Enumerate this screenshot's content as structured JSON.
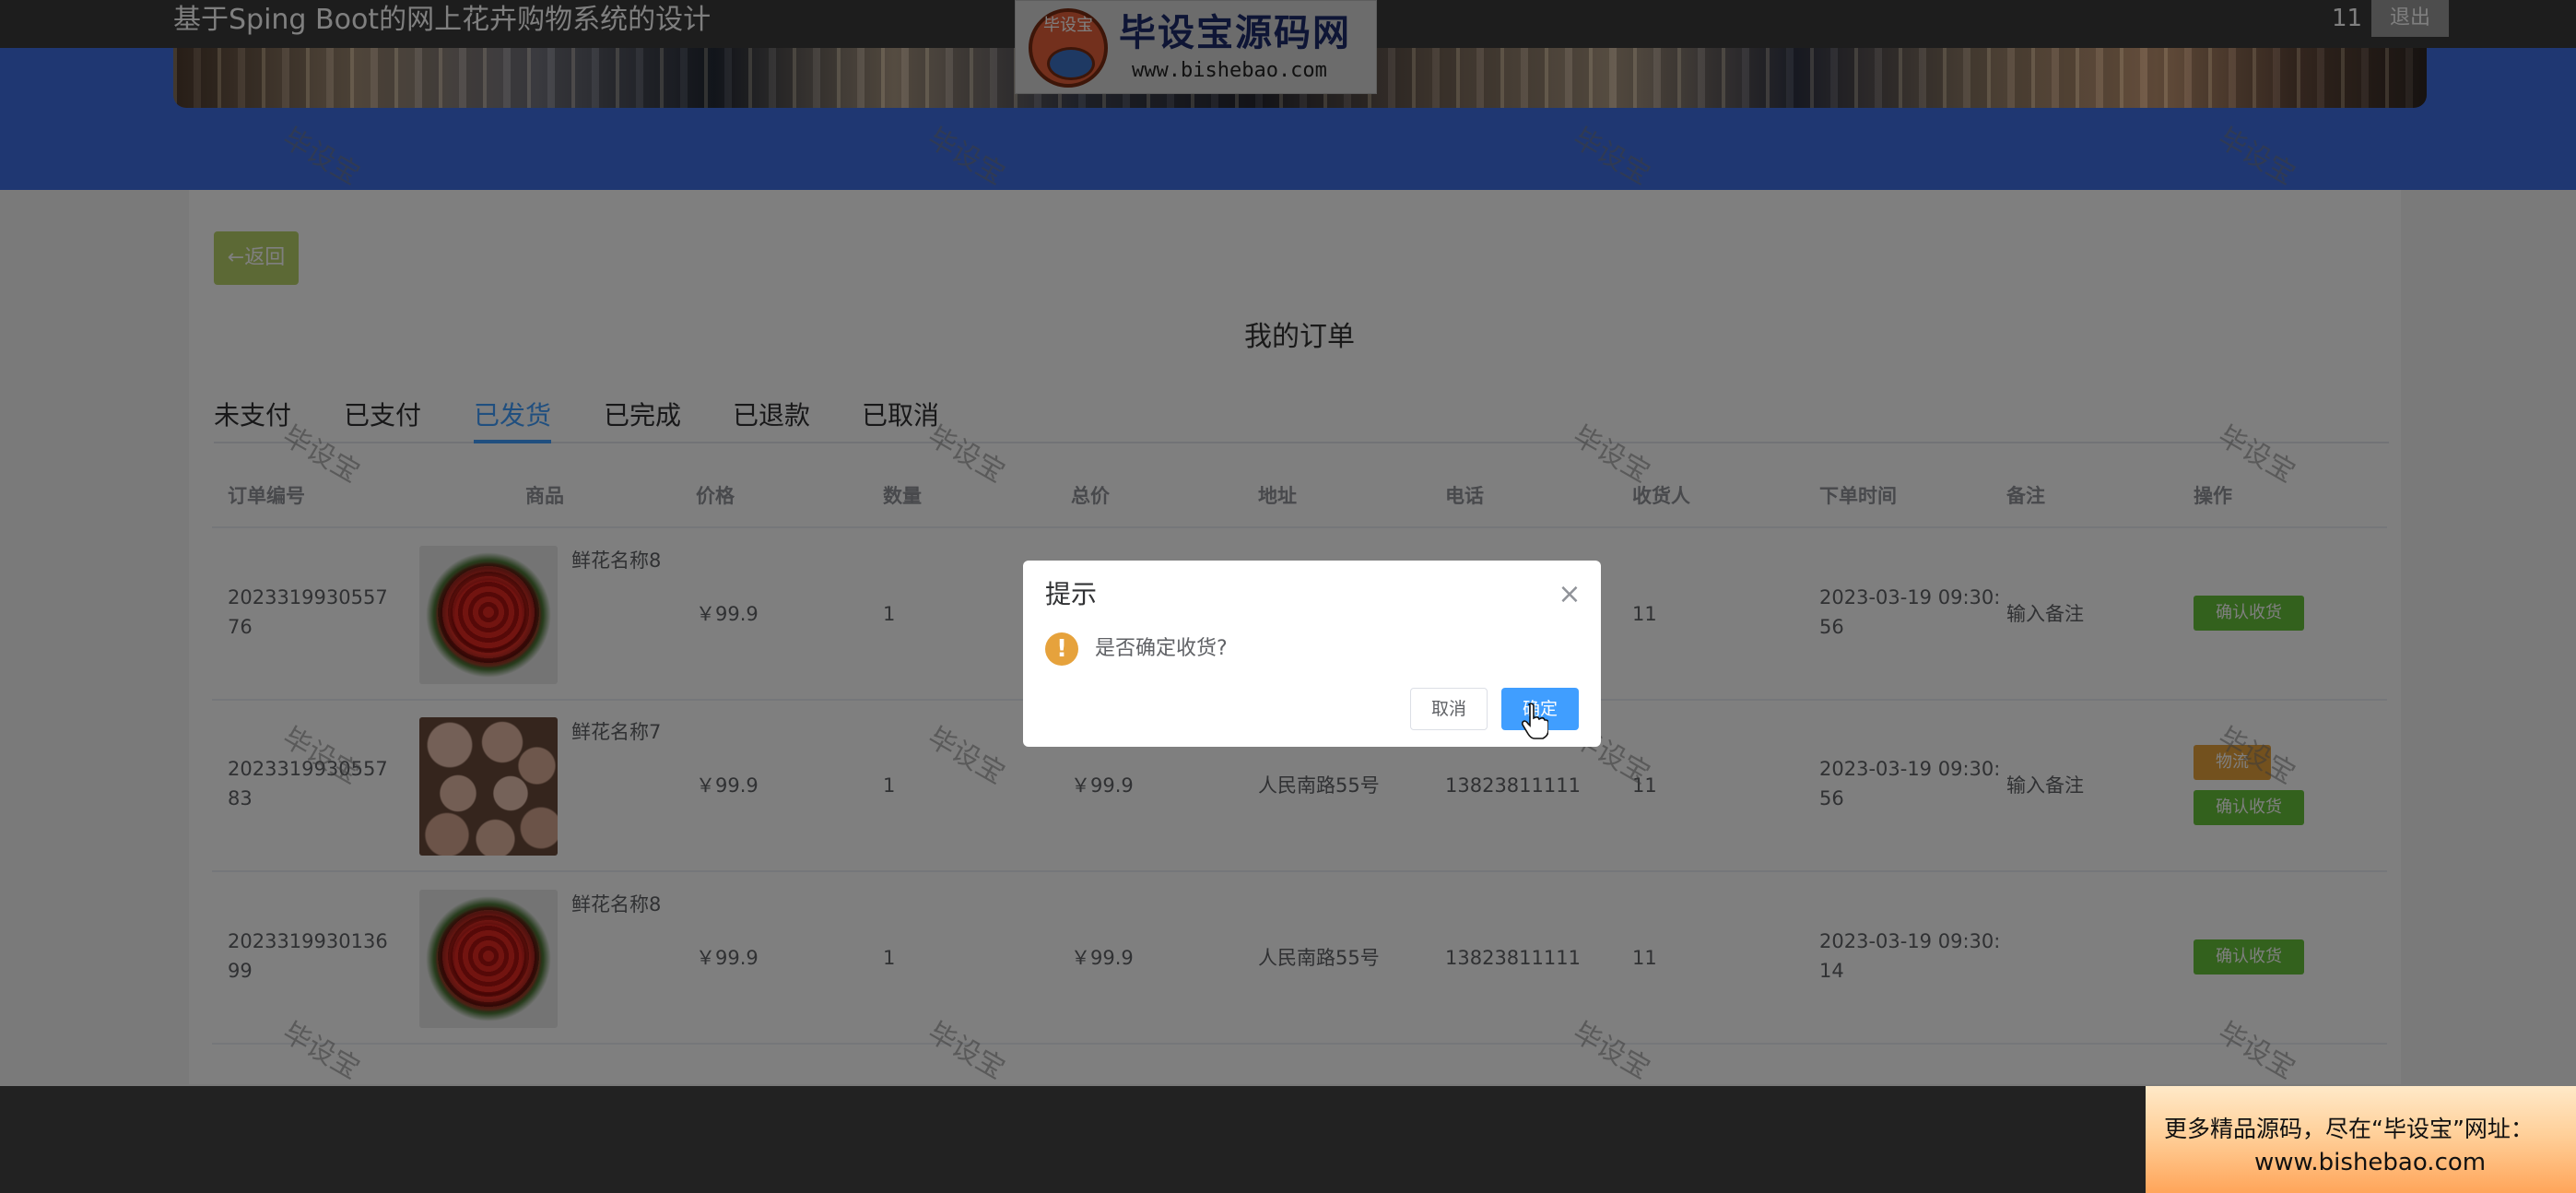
{
  "header": {
    "site_title": "基于Sping Boot的网上花卉购物系统的设计",
    "user_id": "11",
    "logout_label": "退出"
  },
  "logo": {
    "badge": "毕设宝",
    "name": "毕设宝源码网",
    "url": "www.bishebao.com"
  },
  "page": {
    "back_label": "←返回",
    "title": "我的订单"
  },
  "tabs": [
    {
      "label": "未支付",
      "active": false
    },
    {
      "label": "已支付",
      "active": false
    },
    {
      "label": "已发货",
      "active": true
    },
    {
      "label": "已完成",
      "active": false
    },
    {
      "label": "已退款",
      "active": false
    },
    {
      "label": "已取消",
      "active": false
    }
  ],
  "table": {
    "columns": [
      "订单编号",
      "商品",
      "价格",
      "数量",
      "总价",
      "地址",
      "电话",
      "收货人",
      "下单时间",
      "备注",
      "操作"
    ],
    "rows": [
      {
        "order_no": "202331993055776",
        "image": "red-roses",
        "product": "鲜花名称8",
        "price": "￥99.9",
        "quantity": "1",
        "total": "",
        "address": "",
        "phone": "",
        "receiver": "11",
        "time": "2023-03-19 09:30:56",
        "note": "输入备注",
        "actions": [
          "确认收货"
        ]
      },
      {
        "order_no": "202331993055783",
        "image": "peach-roses",
        "product": "鲜花名称7",
        "price": "￥99.9",
        "quantity": "1",
        "total": "￥99.9",
        "address": "人民南路55号",
        "phone": "13823811111",
        "receiver": "11",
        "time": "2023-03-19 09:30:56",
        "note": "输入备注",
        "actions": [
          "物流",
          "确认收货"
        ]
      },
      {
        "order_no": "202331993013699",
        "image": "red-roses",
        "product": "鲜花名称8",
        "price": "￥99.9",
        "quantity": "1",
        "total": "￥99.9",
        "address": "人民南路55号",
        "phone": "13823811111",
        "receiver": "11",
        "time": "2023-03-19 09:30:14",
        "note": "",
        "actions": [
          "确认收货"
        ]
      }
    ]
  },
  "watermark": "毕设宝",
  "dialog": {
    "title": "提示",
    "close_icon": "×",
    "warn_icon": "!",
    "message": "是否确定收货?",
    "cancel_label": "取消",
    "confirm_label": "确定"
  },
  "promo": {
    "line1": "更多精品源码，尽在“毕设宝”网址：",
    "line2": "www.bishebao.com"
  },
  "colors": {
    "primary": "#409eff",
    "success": "#67c23a",
    "warning": "#e6a23c",
    "banner_blue": "#3f6fe5"
  }
}
